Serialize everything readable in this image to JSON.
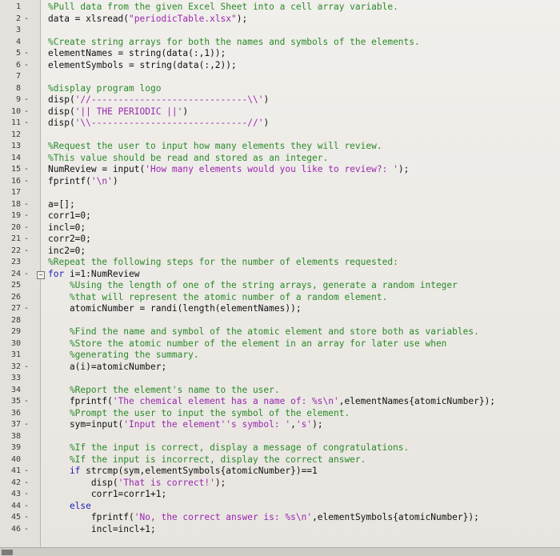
{
  "editor": {
    "lines": [
      {
        "n": "1",
        "mark": "",
        "fold": false,
        "parts": [
          {
            "t": "comment",
            "s": "%Pull data from the given Excel Sheet into a cell array variable."
          }
        ]
      },
      {
        "n": "2",
        "mark": "-",
        "fold": false,
        "parts": [
          {
            "t": "plain",
            "s": "data = xlsread("
          },
          {
            "t": "str",
            "s": "\"periodicTable.xlsx\""
          },
          {
            "t": "plain",
            "s": ");"
          }
        ]
      },
      {
        "n": "3",
        "mark": "",
        "fold": false,
        "parts": []
      },
      {
        "n": "4",
        "mark": "",
        "fold": false,
        "parts": [
          {
            "t": "comment",
            "s": "%Create string arrays for both the names and symbols of the elements."
          }
        ]
      },
      {
        "n": "5",
        "mark": "-",
        "fold": false,
        "parts": [
          {
            "t": "plain",
            "s": "elementNames = string(data(:,1));"
          }
        ]
      },
      {
        "n": "6",
        "mark": "-",
        "fold": false,
        "parts": [
          {
            "t": "plain",
            "s": "elementSymbols = string(data(:,2));"
          }
        ]
      },
      {
        "n": "7",
        "mark": "",
        "fold": false,
        "parts": []
      },
      {
        "n": "8",
        "mark": "",
        "fold": false,
        "parts": [
          {
            "t": "comment",
            "s": "%display program logo"
          }
        ]
      },
      {
        "n": "9",
        "mark": "-",
        "fold": false,
        "parts": [
          {
            "t": "plain",
            "s": "disp("
          },
          {
            "t": "str",
            "s": "'//-----------------------------\\\\'"
          },
          {
            "t": "plain",
            "s": ")"
          }
        ]
      },
      {
        "n": "10",
        "mark": "-",
        "fold": false,
        "parts": [
          {
            "t": "plain",
            "s": "disp("
          },
          {
            "t": "str",
            "s": "'|| THE PERIODIC ||'"
          },
          {
            "t": "plain",
            "s": ")"
          }
        ]
      },
      {
        "n": "11",
        "mark": "-",
        "fold": false,
        "parts": [
          {
            "t": "plain",
            "s": "disp("
          },
          {
            "t": "str",
            "s": "'\\\\-----------------------------//'"
          },
          {
            "t": "plain",
            "s": ")"
          }
        ]
      },
      {
        "n": "12",
        "mark": "",
        "fold": false,
        "parts": []
      },
      {
        "n": "13",
        "mark": "",
        "fold": false,
        "parts": [
          {
            "t": "comment",
            "s": "%Request the user to input how many elements they will review."
          }
        ]
      },
      {
        "n": "14",
        "mark": "",
        "fold": false,
        "parts": [
          {
            "t": "comment",
            "s": "%This value should be read and stored as an integer."
          }
        ]
      },
      {
        "n": "15",
        "mark": "-",
        "fold": false,
        "parts": [
          {
            "t": "plain",
            "s": "NumReview = input("
          },
          {
            "t": "str",
            "s": "'How many elements would you like to review?: '"
          },
          {
            "t": "plain",
            "s": ");"
          }
        ]
      },
      {
        "n": "16",
        "mark": "-",
        "fold": false,
        "parts": [
          {
            "t": "plain",
            "s": "fprintf("
          },
          {
            "t": "str",
            "s": "'\\n'"
          },
          {
            "t": "plain",
            "s": ")"
          }
        ]
      },
      {
        "n": "17",
        "mark": "",
        "fold": false,
        "parts": []
      },
      {
        "n": "18",
        "mark": "-",
        "fold": false,
        "parts": [
          {
            "t": "plain",
            "s": "a=[];"
          }
        ]
      },
      {
        "n": "19",
        "mark": "-",
        "fold": false,
        "parts": [
          {
            "t": "plain",
            "s": "corr1=0;"
          }
        ]
      },
      {
        "n": "20",
        "mark": "-",
        "fold": false,
        "parts": [
          {
            "t": "plain",
            "s": "incl=0;"
          }
        ]
      },
      {
        "n": "21",
        "mark": "-",
        "fold": false,
        "parts": [
          {
            "t": "plain",
            "s": "corr2=0;"
          }
        ]
      },
      {
        "n": "22",
        "mark": "-",
        "fold": false,
        "parts": [
          {
            "t": "plain",
            "s": "inc2=0;"
          }
        ]
      },
      {
        "n": "23",
        "mark": "",
        "fold": false,
        "parts": [
          {
            "t": "comment",
            "s": "%Repeat the following steps for the number of elements requested:"
          }
        ]
      },
      {
        "n": "24",
        "mark": "-",
        "fold": true,
        "parts": [
          {
            "t": "kw",
            "s": "for"
          },
          {
            "t": "plain",
            "s": " i=1:NumReview"
          }
        ]
      },
      {
        "n": "25",
        "mark": "",
        "fold": false,
        "parts": [
          {
            "t": "comment",
            "s": "    %Using the length of one of the string arrays, generate a random integer"
          }
        ]
      },
      {
        "n": "26",
        "mark": "",
        "fold": false,
        "parts": [
          {
            "t": "comment",
            "s": "    %that will represent the atomic number of a random element."
          }
        ]
      },
      {
        "n": "27",
        "mark": "-",
        "fold": false,
        "parts": [
          {
            "t": "plain",
            "s": "    atomicNumber = randi(length(elementNames));"
          }
        ]
      },
      {
        "n": "28",
        "mark": "",
        "fold": false,
        "parts": []
      },
      {
        "n": "29",
        "mark": "",
        "fold": false,
        "parts": [
          {
            "t": "comment",
            "s": "    %Find the name and symbol of the atomic element and store both as variables."
          }
        ]
      },
      {
        "n": "30",
        "mark": "",
        "fold": false,
        "parts": [
          {
            "t": "comment",
            "s": "    %Store the atomic number of the element in an array for later use when"
          }
        ]
      },
      {
        "n": "31",
        "mark": "",
        "fold": false,
        "parts": [
          {
            "t": "comment",
            "s": "    %generating the summary."
          }
        ]
      },
      {
        "n": "32",
        "mark": "-",
        "fold": false,
        "parts": [
          {
            "t": "plain",
            "s": "    a(i)=atomicNumber;"
          }
        ]
      },
      {
        "n": "33",
        "mark": "",
        "fold": false,
        "parts": []
      },
      {
        "n": "34",
        "mark": "",
        "fold": false,
        "parts": [
          {
            "t": "comment",
            "s": "    %Report the element's name to the user."
          }
        ]
      },
      {
        "n": "35",
        "mark": "-",
        "fold": false,
        "parts": [
          {
            "t": "plain",
            "s": "    fprintf("
          },
          {
            "t": "str",
            "s": "'The chemical element has a name of: %s\\n'"
          },
          {
            "t": "plain",
            "s": ",elementNames{atomicNumber});"
          }
        ]
      },
      {
        "n": "36",
        "mark": "",
        "fold": false,
        "parts": [
          {
            "t": "comment",
            "s": "    %Prompt the user to input the symbol of the element."
          }
        ]
      },
      {
        "n": "37",
        "mark": "-",
        "fold": false,
        "parts": [
          {
            "t": "plain",
            "s": "    sym=input("
          },
          {
            "t": "str",
            "s": "'Input the element''s symbol: '"
          },
          {
            "t": "plain",
            "s": ","
          },
          {
            "t": "str",
            "s": "'s'"
          },
          {
            "t": "plain",
            "s": ");"
          }
        ]
      },
      {
        "n": "38",
        "mark": "",
        "fold": false,
        "parts": []
      },
      {
        "n": "39",
        "mark": "",
        "fold": false,
        "parts": [
          {
            "t": "comment",
            "s": "    %If the input is correct, display a message of congratulations."
          }
        ]
      },
      {
        "n": "40",
        "mark": "",
        "fold": false,
        "parts": [
          {
            "t": "comment",
            "s": "    %If the input is incorrect, display the correct answer."
          }
        ]
      },
      {
        "n": "41",
        "mark": "-",
        "fold": false,
        "parts": [
          {
            "t": "kw",
            "s": "    if"
          },
          {
            "t": "plain",
            "s": " strcmp(sym,elementSymbols{atomicNumber})==1"
          }
        ]
      },
      {
        "n": "42",
        "mark": "-",
        "fold": false,
        "parts": [
          {
            "t": "plain",
            "s": "        disp("
          },
          {
            "t": "str",
            "s": "'That is correct!'"
          },
          {
            "t": "plain",
            "s": ");"
          }
        ]
      },
      {
        "n": "43",
        "mark": "-",
        "fold": false,
        "parts": [
          {
            "t": "plain",
            "s": "        corr1=corr1+1;"
          }
        ]
      },
      {
        "n": "44",
        "mark": "-",
        "fold": false,
        "parts": [
          {
            "t": "kw",
            "s": "    else"
          }
        ]
      },
      {
        "n": "45",
        "mark": "-",
        "fold": false,
        "parts": [
          {
            "t": "plain",
            "s": "        fprintf("
          },
          {
            "t": "str",
            "s": "'No, the correct answer is: %s\\n'"
          },
          {
            "t": "plain",
            "s": ",elementSymbols{atomicNumber});"
          }
        ]
      },
      {
        "n": "46",
        "mark": "-",
        "fold": false,
        "parts": [
          {
            "t": "plain",
            "s": "        incl=incl+1;"
          }
        ]
      }
    ]
  },
  "colors": {
    "comment": "#2a8a2a",
    "keyword": "#1f1fb5",
    "string": "#9a27b0"
  }
}
